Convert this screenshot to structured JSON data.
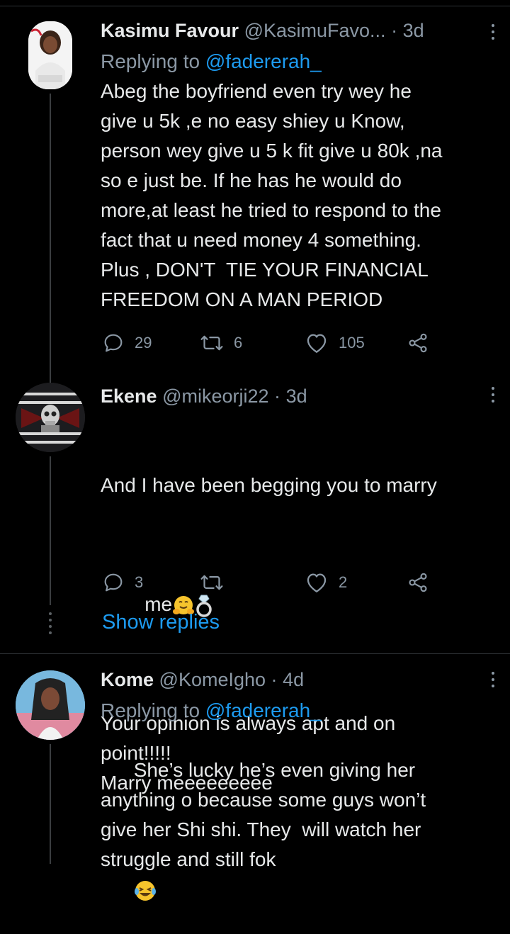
{
  "tweets": [
    {
      "name": "Kasimu Favour",
      "handle": "@KasimuFavo...",
      "sep": "·",
      "time": "3d",
      "replying_prefix": "Replying to",
      "replying_to": "@fadererah_",
      "body": "Abeg the boyfriend even try wey he\ngive u 5k ,e no easy shiey u Know,\nperson wey give u 5 k fit give u 80k ,na\nso e just be. If he has he would do\nmore,at least he tried to respond to the\nfact that u need money 4 something.\nPlus , DON'T  TIE YOUR FINANCIAL\nFREEDOM ON A MAN PERIOD",
      "replies": "29",
      "retweets": "6",
      "likes": "105"
    },
    {
      "name": "Ekene",
      "handle": "@mikeorji22",
      "sep": "·",
      "time": "3d",
      "body_line1": "And I have been begging you to marry",
      "body_line2": "me",
      "body_rest": "Your opinion is always apt and on\npoint!!!!!\nMarry meeeeeeeee",
      "replies": "3",
      "retweets": "",
      "likes": "2"
    },
    {
      "name": "Kome",
      "handle": "@KomeIgho",
      "sep": "·",
      "time": "4d",
      "replying_prefix": "Replying to",
      "replying_to": "@fadererah_",
      "body": "She’s lucky he’s even giving her\nanything o because some guys won’t\ngive her Shi shi. They  will watch her\nstruggle and still fok"
    }
  ],
  "show_replies": "Show replies",
  "colors": {
    "background": "#000000",
    "text": "#e7e9ea",
    "muted": "#8b98a5",
    "accent": "#1d9bf0",
    "divider": "#2f3336"
  },
  "icons": [
    "reply-icon",
    "retweet-icon",
    "like-icon",
    "share-icon",
    "more-icon",
    "hugging-face-emoji",
    "ring-emoji",
    "laughing-emoji"
  ]
}
